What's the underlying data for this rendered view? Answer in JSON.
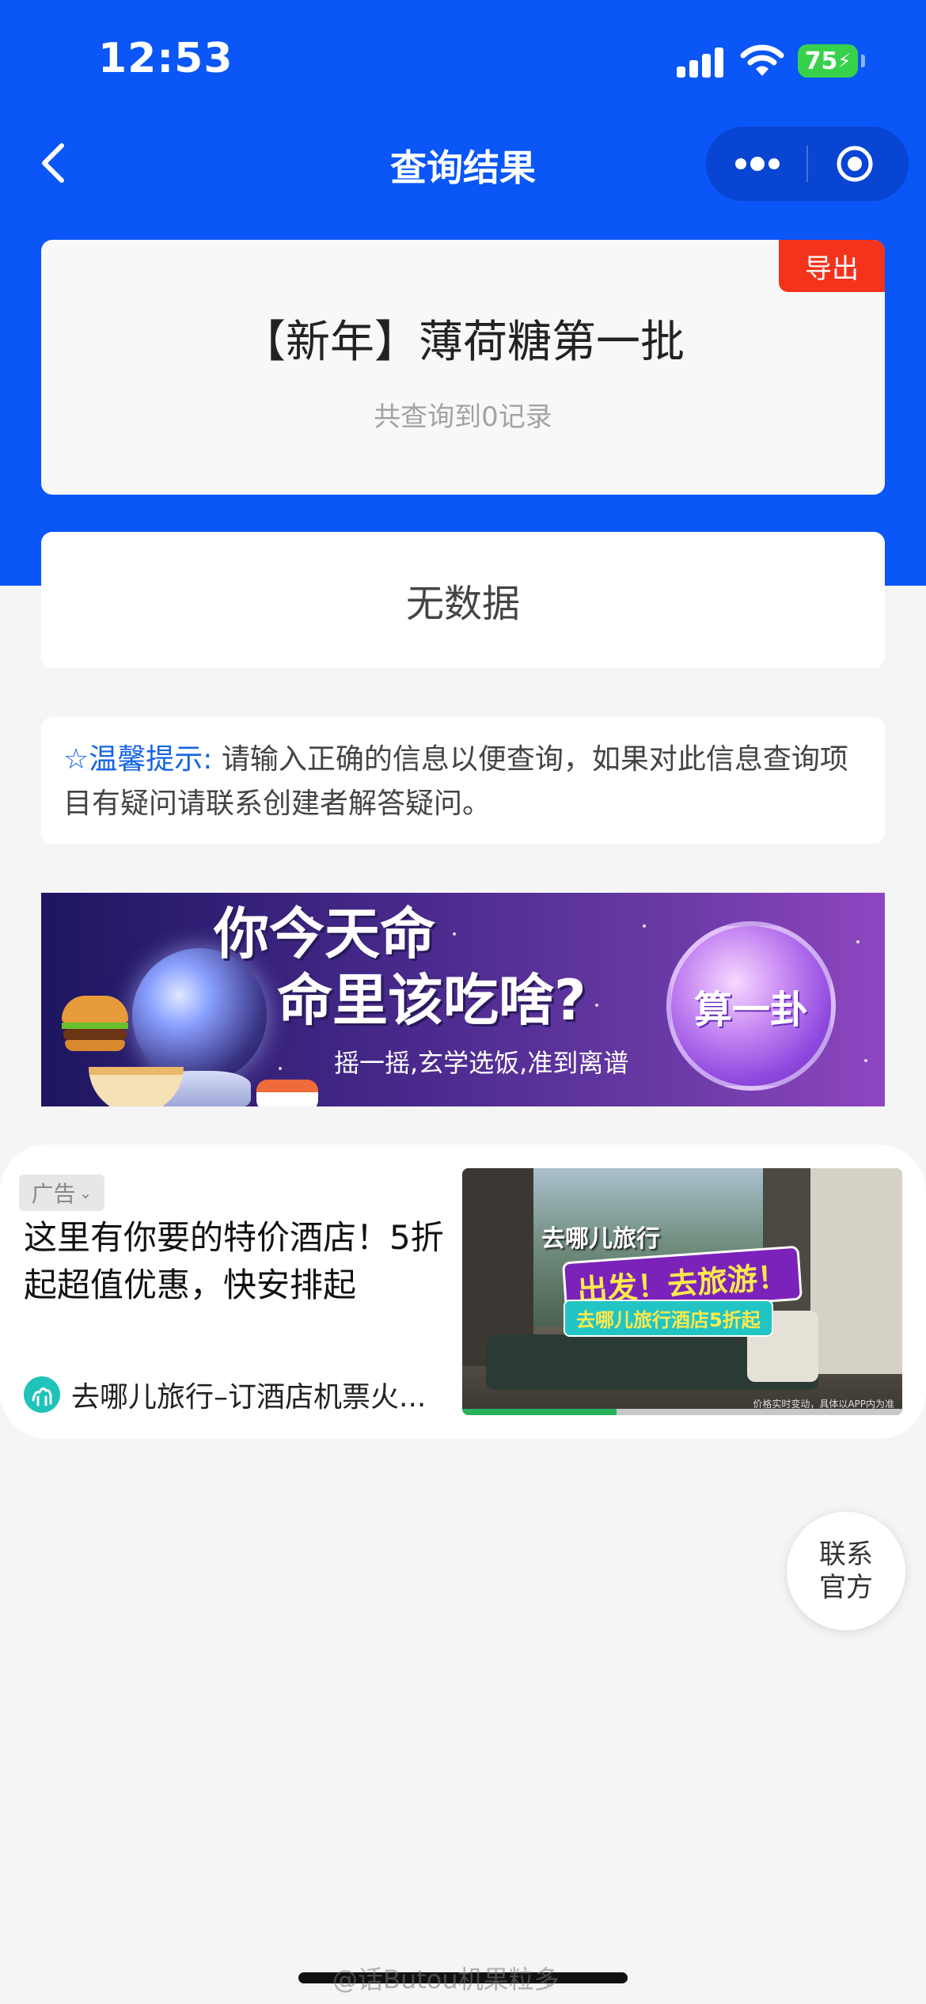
{
  "status_bar": {
    "time": "12:53",
    "battery": "75"
  },
  "nav": {
    "title": "查询结果"
  },
  "result": {
    "export_label": "导出",
    "title": "【新年】薄荷糖第一批",
    "count": "共查询到0记录"
  },
  "empty_state": {
    "text": "无数据"
  },
  "tip": {
    "label": "☆温馨提示:",
    "text": "请输入正确的信息以便查询，如果对此信息查询项目有疑问请联系创建者解答疑问。"
  },
  "banner": {
    "title_line1": "你今天命",
    "title_line2": "命里该吃啥?",
    "subtitle": "摇一摇,玄学选饭,准到离谱",
    "button": "算一卦"
  },
  "ad": {
    "badge": "广告",
    "title": "这里有你要的特价酒店！5折起超值优惠，快安排起",
    "source": "去哪儿旅行–订酒店机票火...",
    "image_brand": "去哪儿旅行",
    "image_slogan": "出发！去旅游！",
    "image_promo": "去哪儿旅行酒店5折起",
    "image_fineprint": "价格实时变动，具体以APP内为准",
    "video_progress": 0.35
  },
  "contact": {
    "label": "联系官方"
  },
  "watermark": "@话Butou机果粒多",
  "colors": {
    "primary_blue": "#0a56f6",
    "export_red": "#f4331c",
    "tip_blue": "#1464e6"
  }
}
